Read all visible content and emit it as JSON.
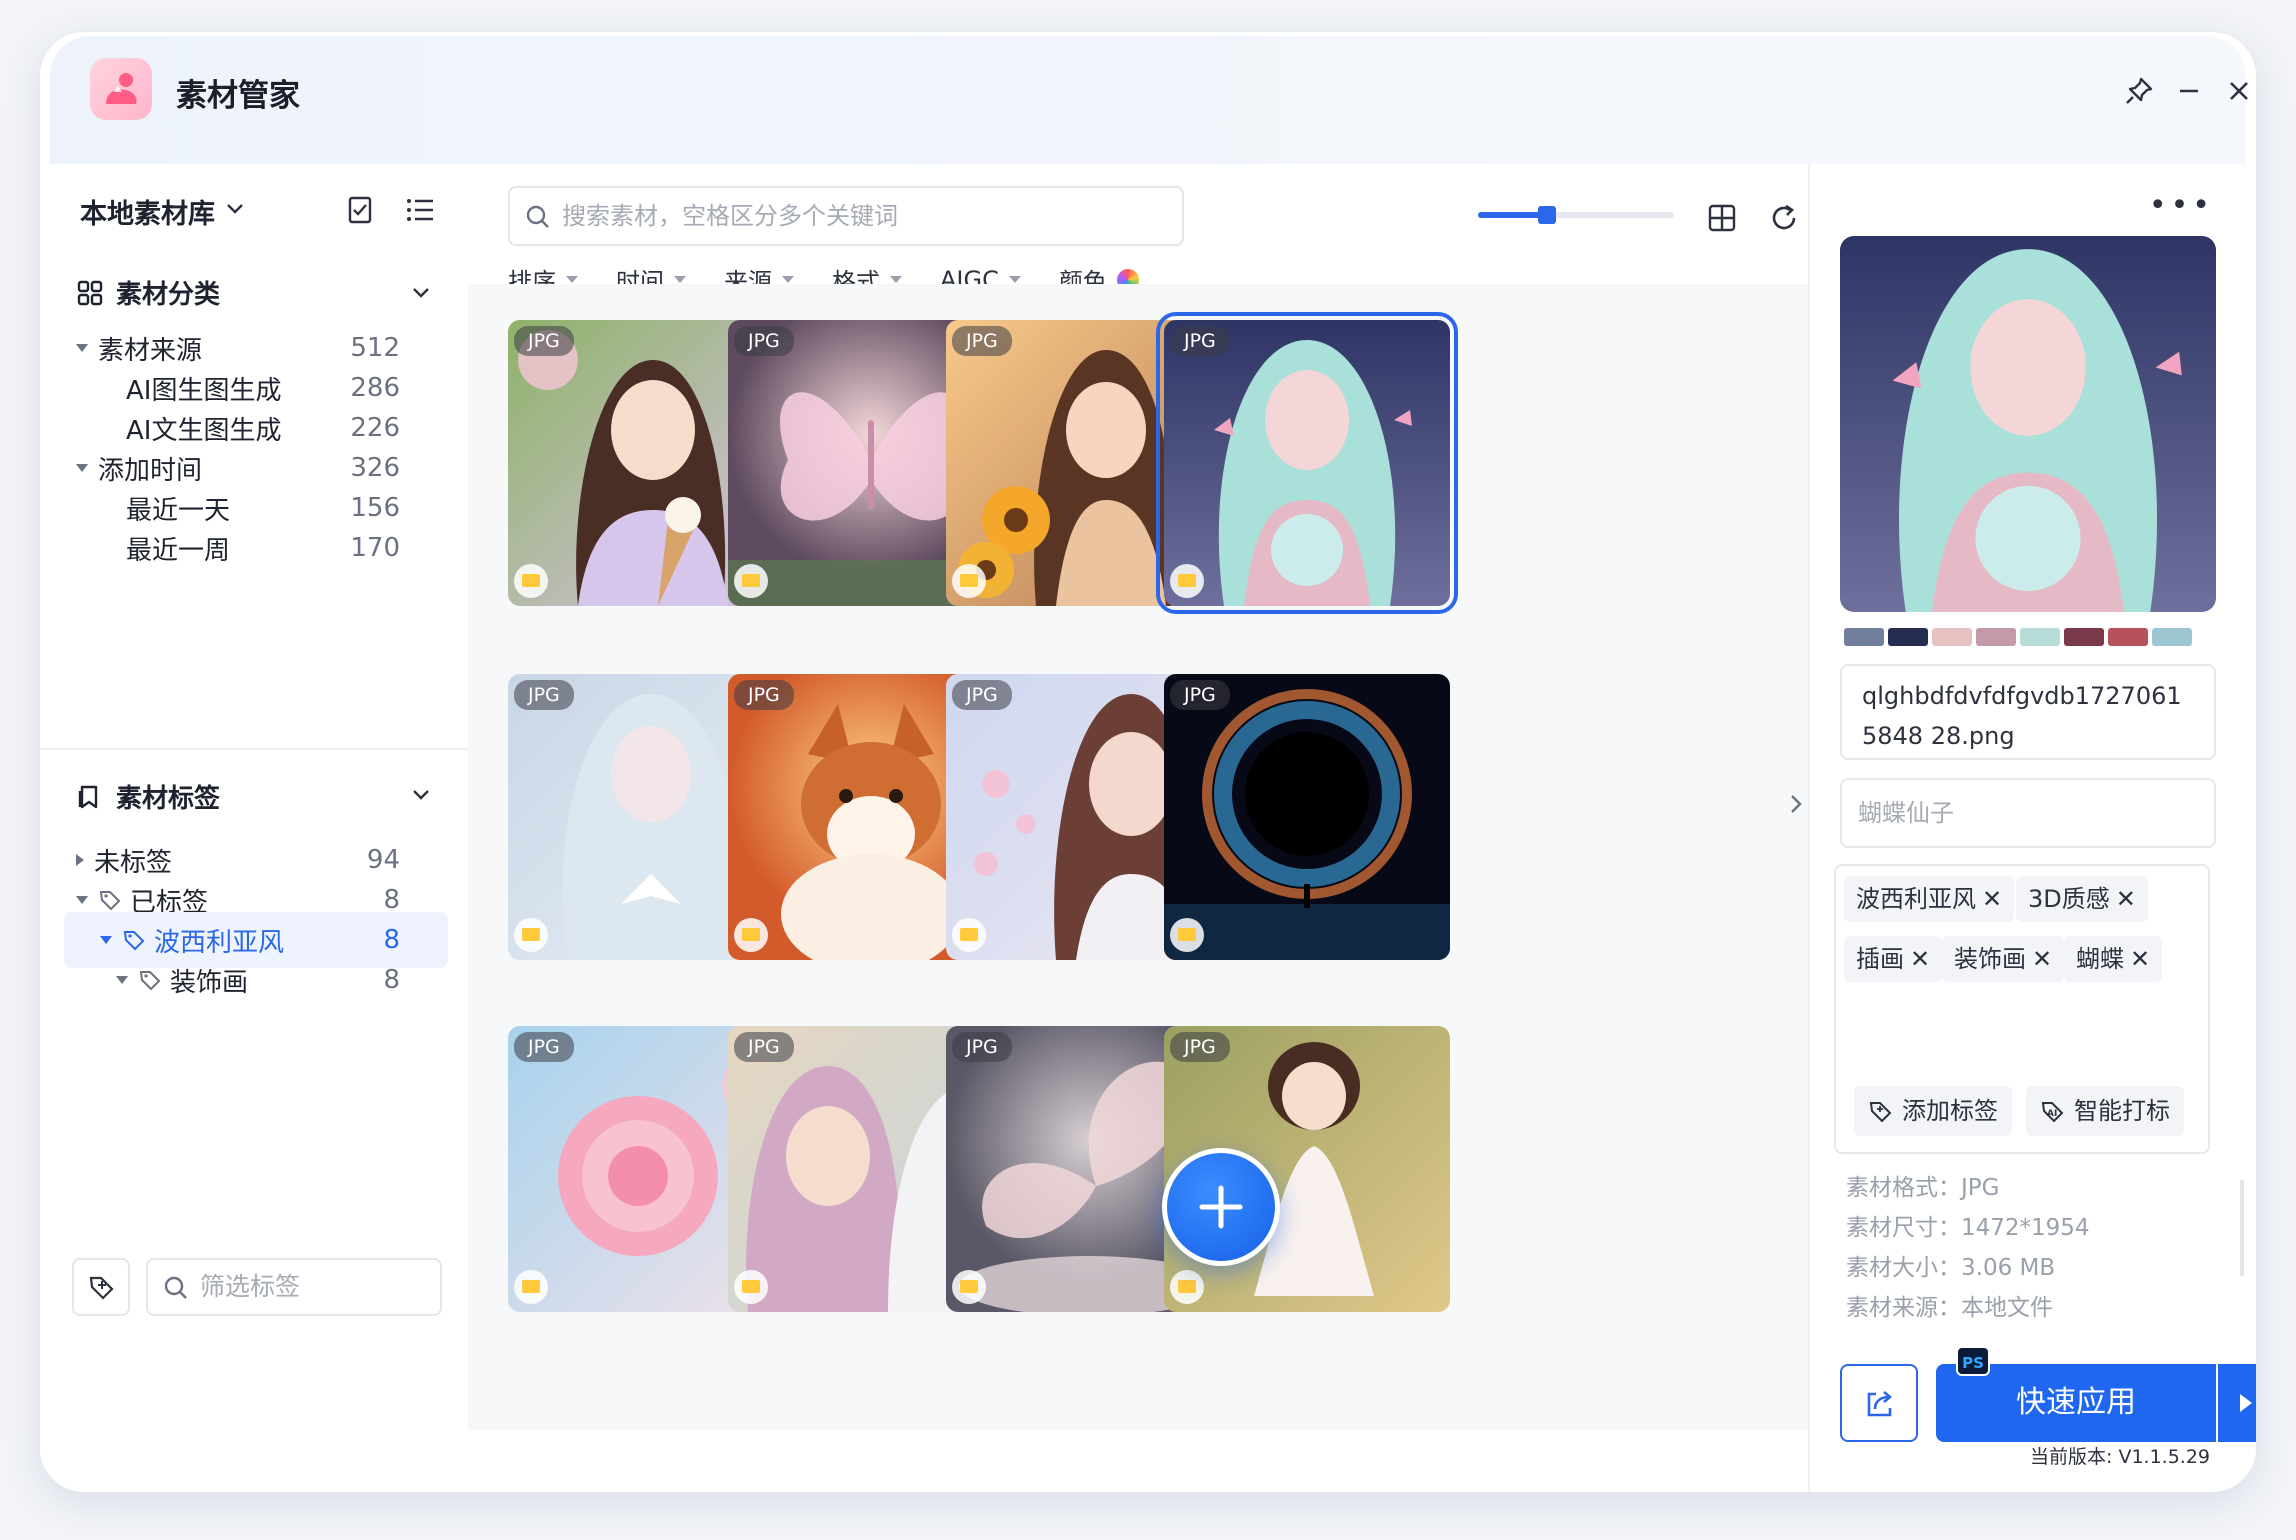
{
  "app": {
    "title": "素材管家"
  },
  "sidebar": {
    "library_title": "本地素材库",
    "category_section": "素材分类",
    "category_tree": [
      {
        "label": "素材来源",
        "count": "512"
      },
      {
        "label": "AI图生图生成",
        "count": "286"
      },
      {
        "label": "AI文生图生成",
        "count": "226"
      },
      {
        "label": "添加时间",
        "count": "326"
      },
      {
        "label": "最近一天",
        "count": "156"
      },
      {
        "label": "最近一周",
        "count": "170"
      }
    ],
    "tag_section": "素材标签",
    "tag_tree": [
      {
        "label": "未标签",
        "count": "94"
      },
      {
        "label": "已标签",
        "count": "8"
      },
      {
        "label": "波西利亚风",
        "count": "8"
      },
      {
        "label": "装饰画",
        "count": "8"
      }
    ],
    "filter_placeholder": "筛选标签"
  },
  "main": {
    "search_placeholder": "搜索素材，空格区分多个关键词",
    "slider_value": 0.35,
    "filters": [
      "排序",
      "时间",
      "来源",
      "格式",
      "AIGC",
      "颜色"
    ],
    "cards": [
      {
        "badge": "JPG",
        "subject": "girl-ice-cream"
      },
      {
        "badge": "JPG",
        "subject": "crystal-butterfly"
      },
      {
        "badge": "JPG",
        "subject": "girl-sunflowers"
      },
      {
        "badge": "JPG",
        "subject": "butterfly-fairy"
      },
      {
        "badge": "JPG",
        "subject": "silver-fairy"
      },
      {
        "badge": "JPG",
        "subject": "corgi-puppy"
      },
      {
        "badge": "JPG",
        "subject": "blossom-woman"
      },
      {
        "badge": "JPG",
        "subject": "black-hole"
      },
      {
        "badge": "JPG",
        "subject": "pink-rose"
      },
      {
        "badge": "JPG",
        "subject": "girl-unicorn"
      },
      {
        "badge": "JPG",
        "subject": "glass-butterfly"
      },
      {
        "badge": "JPG",
        "subject": "little-princess"
      }
    ]
  },
  "panel": {
    "swatches": [
      "#6f7f9c",
      "#262f52",
      "#e7c2c3",
      "#c49aa9",
      "#b8ddd8",
      "#7a3a4c",
      "#b7515b",
      "#9dc6d2"
    ],
    "filename": "qlghbdfdvfdfgvdb17270615848 28.png",
    "description": "蝴蝶仙子",
    "tags": [
      "波西利亚风",
      "3D质感",
      "插画",
      "装饰画",
      "蝴蝶"
    ],
    "add_tag": "添加标签",
    "smart_tag": "智能打标",
    "meta": [
      "素材格式：JPG",
      "素材尺寸：1472*1954",
      "素材大小：3.06 MB",
      "素材来源：本地文件"
    ],
    "ps_badge": "PS",
    "apply_label": "快速应用",
    "version": "当前版本: V1.1.5.29"
  }
}
